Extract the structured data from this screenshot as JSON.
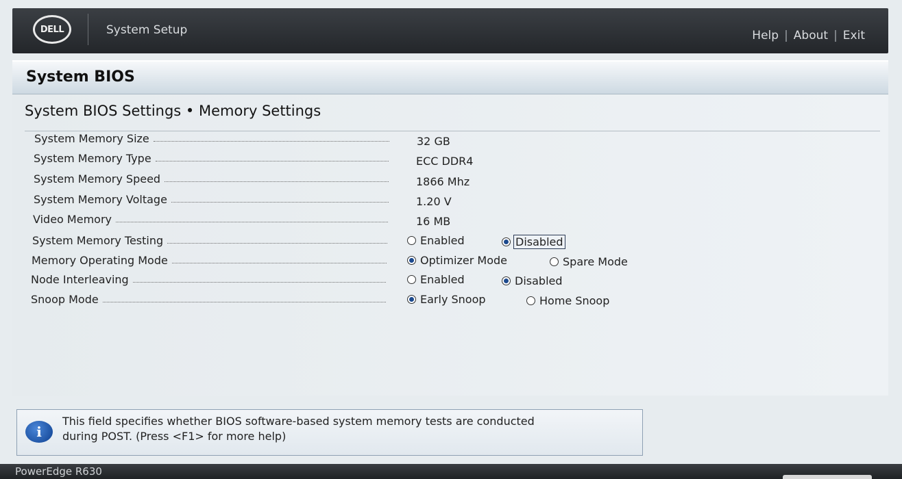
{
  "header": {
    "logo_text": "DELL",
    "app_title": "System Setup",
    "links": [
      "Help",
      "About",
      "Exit"
    ],
    "link_separator": "|"
  },
  "section": {
    "title": "System BIOS"
  },
  "page": {
    "title": "System BIOS Settings • Memory Settings"
  },
  "settings": [
    {
      "label": "System Memory Size",
      "value": "32 GB"
    },
    {
      "label": "System Memory Type",
      "value": "ECC DDR4"
    },
    {
      "label": "System Memory Speed",
      "value": "1866 Mhz"
    },
    {
      "label": "System Memory Voltage",
      "value": "1.20 V"
    },
    {
      "label": "Video Memory",
      "value": "16 MB"
    },
    {
      "label": "System Memory Testing",
      "options": [
        "Enabled",
        "Disabled"
      ],
      "selected": "Disabled"
    },
    {
      "label": "Memory Operating Mode",
      "options": [
        "Optimizer Mode",
        "Spare Mode"
      ],
      "selected": "Optimizer Mode"
    },
    {
      "label": "Node Interleaving",
      "options": [
        "Enabled",
        "Disabled"
      ],
      "selected": "Disabled"
    },
    {
      "label": "Snoop Mode",
      "options": [
        "Early Snoop",
        "Home Snoop"
      ],
      "selected": "Early Snoop"
    }
  ],
  "help": {
    "line1": "This field specifies whether BIOS software-based system memory tests are conducted",
    "line2": "during POST. (Press <F1> for more help)",
    "icon": "info-icon"
  },
  "footer": {
    "model": "PowerEdge R630"
  },
  "colors": {
    "header_bg": "#2a2d31",
    "section_bg": "#cdd9e2",
    "radio_fill": "#1c4a8e"
  }
}
